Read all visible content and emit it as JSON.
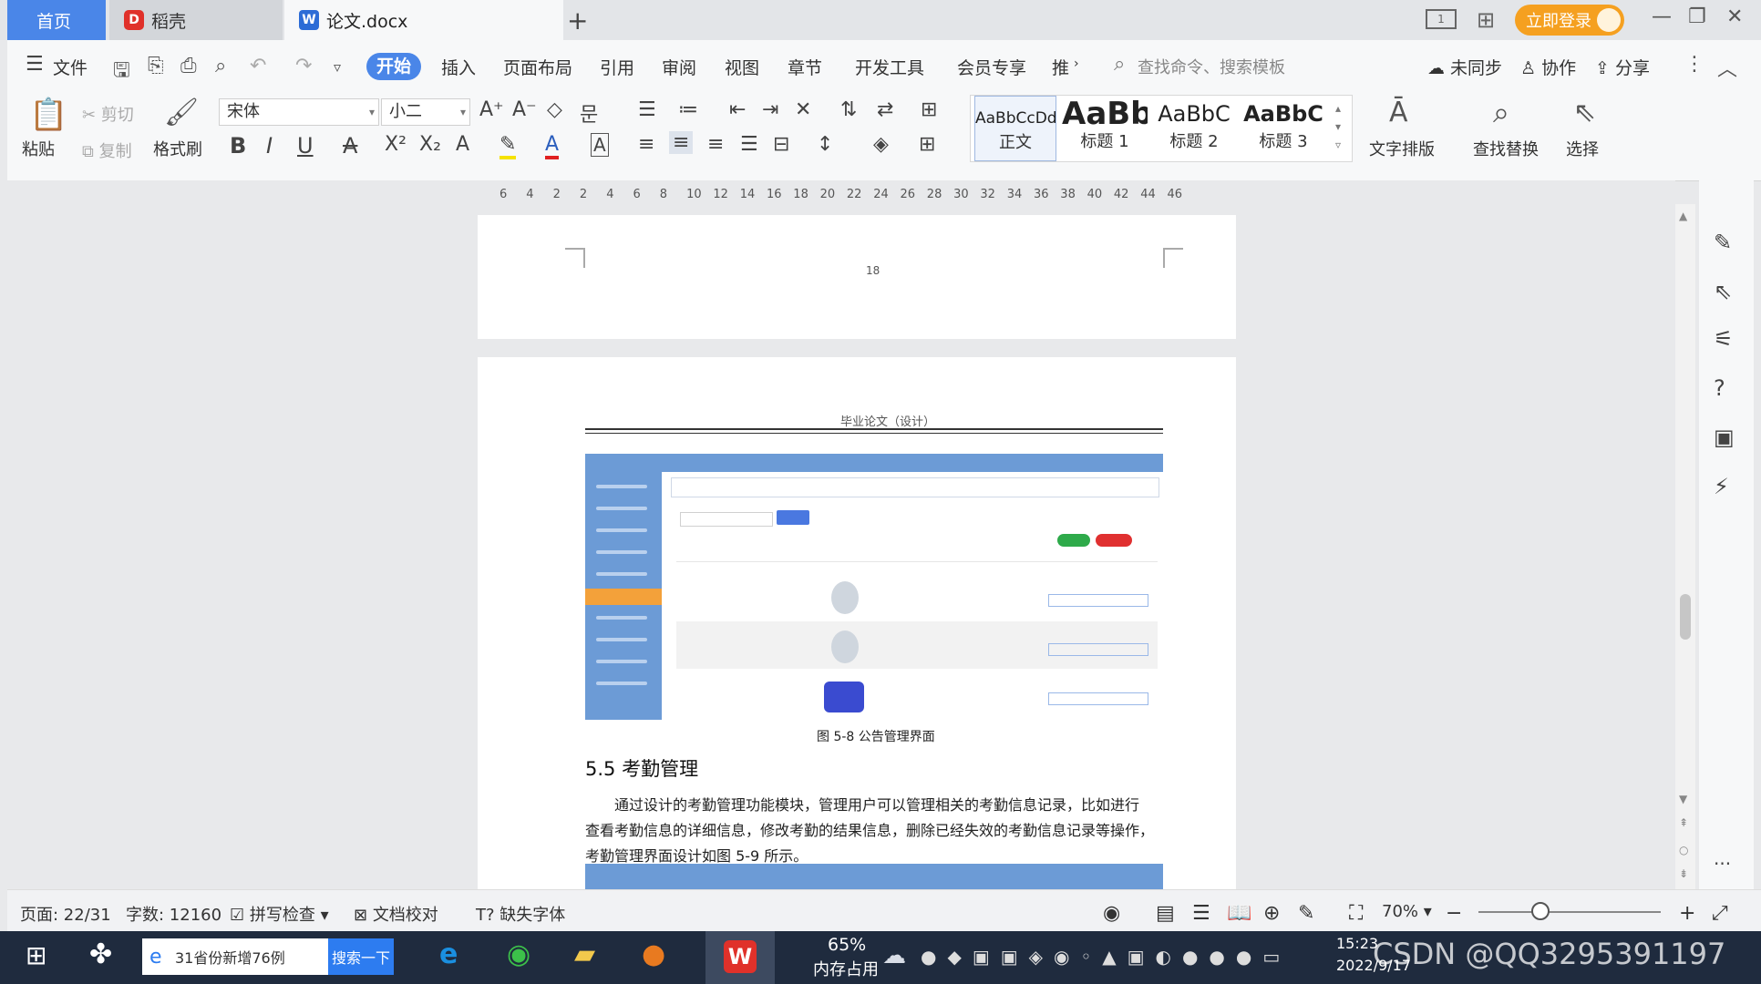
{
  "tabs": {
    "home": "首页",
    "daoke": "稻壳",
    "doc": "论文.docx",
    "new_tab": "+"
  },
  "titlebar": {
    "login": "立即登录"
  },
  "menu": {
    "file": "文件",
    "items": [
      "开始",
      "插入",
      "页面布局",
      "引用",
      "审阅",
      "视图",
      "章节",
      "开发工具",
      "会员专享",
      "推"
    ],
    "search_placeholder": "查找命令、搜索模板",
    "sync": "未同步",
    "collab": "协作",
    "share": "分享"
  },
  "ribbon": {
    "paste": "粘贴",
    "cut": "剪切",
    "copy": "复制",
    "format_painter": "格式刷",
    "font_name": "宋体",
    "font_size": "小二",
    "styles": [
      {
        "sample": "AaBbCcDd",
        "label": "正文"
      },
      {
        "sample": "AaBb",
        "label": "标题 1"
      },
      {
        "sample": "AaBbC",
        "label": "标题 2"
      },
      {
        "sample": "AaBbC",
        "label": "标题 3"
      }
    ],
    "text_layout": "文字排版",
    "find_replace": "查找替换",
    "select": "选择"
  },
  "ruler": {
    "numbers": [
      "6",
      "4",
      "2",
      "2",
      "4",
      "6",
      "8",
      "10",
      "12",
      "14",
      "16",
      "18",
      "20",
      "22",
      "24",
      "26",
      "28",
      "30",
      "32",
      "34",
      "36",
      "38",
      "40",
      "42",
      "44",
      "46"
    ]
  },
  "document": {
    "page_number": "18",
    "header": "毕业论文（设计）",
    "figure_caption": "图 5-8 公告管理界面",
    "section_title": "5.5 考勤管理",
    "paragraph_lines": [
      "通过设计的考勤管理功能模块，管理用户可以管理相关的考勤信息记录，比如进行",
      "查看考勤信息的详细信息，修改考勤的结果信息，删除已经失效的考勤信息记录等操作，",
      "考勤管理界面设计如图 5-9 所示。"
    ]
  },
  "status": {
    "page": "页面: 22/31",
    "words": "字数: 12160",
    "spell": "拼写检查",
    "proof": "文档校对",
    "missing_font": "缺失字体",
    "zoom": "70%"
  },
  "taskbar": {
    "search_text": "31省份新增76例",
    "search_button": "搜索一下",
    "memory_percent": "65%",
    "memory_label": "内存占用",
    "time": "15:23",
    "date": "2022/9/17",
    "watermark": "CSDN @QQ3295391197"
  }
}
